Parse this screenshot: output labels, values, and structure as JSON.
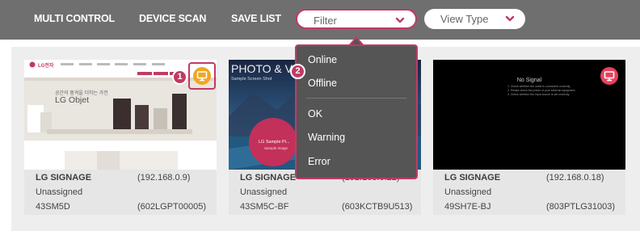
{
  "nav": {
    "multi_control": "MULTI CONTROL",
    "device_scan": "DEVICE SCAN",
    "save_list": "SAVE LIST",
    "filter_label": "Filter",
    "view_type_label": "View Type"
  },
  "filter_menu": {
    "items": [
      "Online",
      "Offline",
      "OK",
      "Warning",
      "Error"
    ]
  },
  "callouts": [
    "1",
    "2"
  ],
  "devices": [
    {
      "name": "LG SIGNAGE",
      "ip": "(192.168.0.9)",
      "group": "Unassigned",
      "model": "43SM5D",
      "serial": "(602LGPT00005)",
      "status_color": "#f0a623"
    },
    {
      "name": "LG SIGNAGE",
      "ip": "(192.168.0.22)",
      "group": "Unassigned",
      "model": "43SM5C-BF",
      "serial": "(603KCTB9U513)",
      "status_color": "#e8415f"
    },
    {
      "name": "LG SIGNAGE",
      "ip": "(192.168.0.18)",
      "group": "Unassigned",
      "model": "49SH7E-BJ",
      "serial": "(803PTLG31003)",
      "status_color": "#e8415f"
    }
  ],
  "thumb1": {
    "brand": "LG전자",
    "headline_small": "공간의 품격을 더하는 가전",
    "headline": "LG Objet"
  },
  "thumb2": {
    "title": "PHOTO & VIDEO",
    "subtitle": "Sample Screen Shot",
    "circle_text": "LG Sample Pi...",
    "circle_sub": "Sample Image"
  },
  "thumb3": {
    "title": "No Signal",
    "lines": [
      "1. Check whether the cable is connected correctly.",
      "2. Please check the power of your external equipment.",
      "3. Check whether the input source is set correctly."
    ]
  },
  "colors": {
    "accent": "#c13a63",
    "topbar": "#6f6f6f",
    "menu_bg": "#555555"
  }
}
